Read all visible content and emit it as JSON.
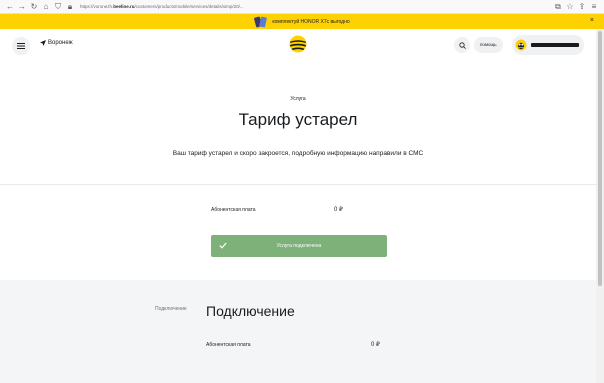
{
  "browser": {
    "url_prefix": "https://voronezh.",
    "url_domain": "beeline.ru",
    "url_rest": "/customers/products/mobile/services/details/simp/20/..."
  },
  "promo": {
    "text": "комплектуй HONOR X7c выгодно",
    "close": "×"
  },
  "header": {
    "city": "Воронеж",
    "help_label": "помощь"
  },
  "hero": {
    "label": "Услуга",
    "title": "Тариф устарел",
    "description": "Ваш тариф устарел и скоро закроется, подробную информацию направили в СМС"
  },
  "fee": {
    "label": "Абонентская плата",
    "value": "0 ₽"
  },
  "connected_button": {
    "label": "Услуга подключена"
  },
  "connection_section": {
    "side_label": "Подключение",
    "title": "Подключение",
    "fee_label": "Абонентская плата",
    "fee_value": "0 ₽"
  },
  "colors": {
    "brand_yellow": "#fed200",
    "success_green": "#7eb07a",
    "section_gray": "#f4f5f6"
  }
}
